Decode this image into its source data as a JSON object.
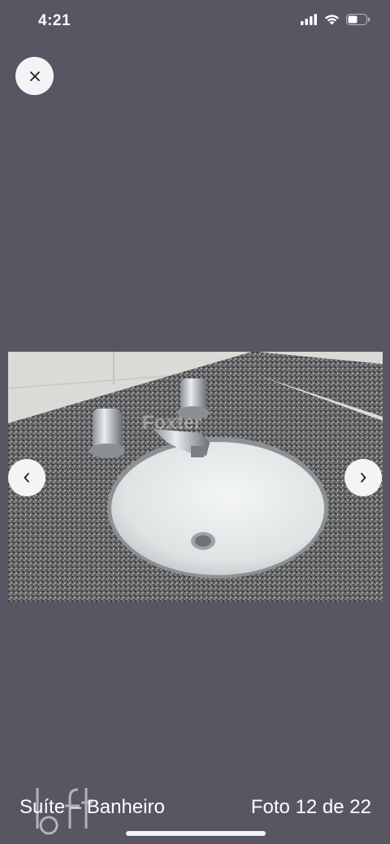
{
  "status_bar": {
    "time": "4:21",
    "icons": [
      "signal-icon",
      "wifi-icon",
      "battery-icon"
    ]
  },
  "viewer": {
    "close_icon": "close-icon",
    "prev_icon": "chevron-left-icon",
    "next_icon": "chevron-right-icon",
    "caption": "Suíte – Banheiro",
    "counter": "Foto 12 de 22",
    "logo": "loft",
    "photo_watermark": "Foxter"
  },
  "colors": {
    "background": "#575663",
    "button_bg": "#f4f4f6",
    "text": "#ffffff"
  }
}
